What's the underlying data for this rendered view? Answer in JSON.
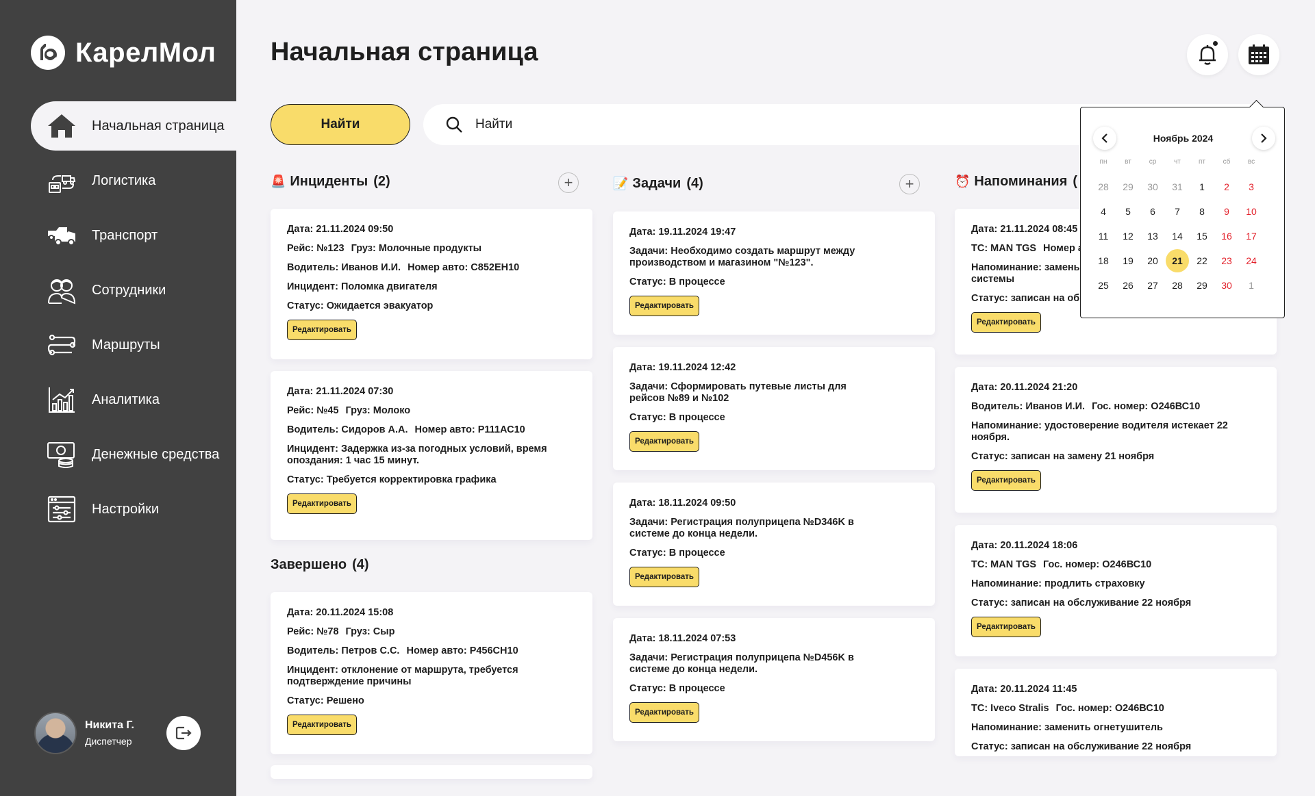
{
  "app": {
    "name": "КарелМол"
  },
  "sidebar": {
    "items": [
      {
        "label": "Начальная страница",
        "icon": "home-icon",
        "active": true
      },
      {
        "label": "Логистика",
        "icon": "logistics-icon"
      },
      {
        "label": "Транспорт",
        "icon": "truck-icon"
      },
      {
        "label": "Сотрудники",
        "icon": "employees-icon"
      },
      {
        "label": "Маршруты",
        "icon": "routes-icon"
      },
      {
        "label": "Аналитика",
        "icon": "analytics-icon"
      },
      {
        "label": "Денежные средства",
        "icon": "money-icon"
      },
      {
        "label": "Настройки",
        "icon": "settings-icon"
      }
    ]
  },
  "user": {
    "name": "Никита Г.",
    "role": "Диспетчер"
  },
  "header": {
    "title": "Начальная страница"
  },
  "search": {
    "button_label": "Найти",
    "placeholder": "Найти"
  },
  "edit_label": "Редактировать",
  "incidents": {
    "title": "Инциденты",
    "count": "(2)",
    "cards": [
      {
        "l1": "Дата: 21.11.2024 09:50",
        "l2a": "Рейс: №123",
        "l2b": "Груз: Молочные продукты",
        "l3a": "Водитель: Иванов И.И.",
        "l3b": "Номер авто: С852ЕН10",
        "l4": "Инцидент: Поломка двигателя",
        "l5": "Статус: Ожидается эвакуатор"
      },
      {
        "l1": "Дата: 21.11.2024 07:30",
        "l2a": "Рейс: №45",
        "l2b": "Груз: Молоко",
        "l3a": "Водитель: Сидоров А.А.",
        "l3b": "Номер авто: Р111АС10",
        "l4": "Инцидент: Задержка из-за погодных условий, время опоздания: 1 час 15 минут.",
        "l5": "Статус: Требуется корректировка графика"
      }
    ]
  },
  "completed": {
    "title": "Завершено",
    "count": "(4)",
    "cards": [
      {
        "l1": "Дата: 20.11.2024 15:08",
        "l2a": "Рейс: №78",
        "l2b": "Груз: Сыр",
        "l3a": "Водитель: Петров С.С.",
        "l3b": "Номер авто: Р456СН10",
        "l4": "Инцидент: отклонение от маршрута, требуется подтверждение причины",
        "l5": "Статус: Решено"
      }
    ]
  },
  "tasks": {
    "title": "Задачи",
    "count": "(4)",
    "cards": [
      {
        "date": "Дата: 19.11.2024 19:47",
        "text": "Задачи: Необходимо создать маршрут между производством и магазином \"№123\".",
        "status": "Статус: В процессе"
      },
      {
        "date": "Дата: 19.11.2024 12:42",
        "text": "Задачи: Сформировать путевые листы для рейсов №89 и №102",
        "status": "Статус: В процессе"
      },
      {
        "date": "Дата: 18.11.2024 09:50",
        "text": "Задачи: Регистрация полуприцепа №D346K в системе до конца недели.",
        "status": "Статус: В процессе"
      },
      {
        "date": "Дата: 18.11.2024 07:53",
        "text": "Задачи: Регистрация полуприцепа №D456K в системе до конца недели.",
        "status": "Статус: В процессе"
      }
    ]
  },
  "reminders": {
    "title": "Напоминания",
    "count": "(",
    "cards": [
      {
        "l1": "Дата: 21.11.2024 08:45",
        "l2a": "ТС: MAN TGS",
        "l2b": "Номер а",
        "l3": "Напоминание: замены системы",
        "l4": "Статус: записан на об"
      },
      {
        "l1": "Дата: 20.11.2024 21:20",
        "l2a": "Водитель: Иванов И.И.",
        "l2b": "Гос. номер: О246ВС10",
        "l3": "Напоминание: удостоверение водителя истекает 22 ноября.",
        "l4": "Статус: записан на замену 21 ноября"
      },
      {
        "l1": "Дата: 20.11.2024 18:06",
        "l2a": "ТС: MAN TGS",
        "l2b": "Гос. номер: О246ВС10",
        "l3": "Напоминание: продлить страховку",
        "l4": "Статус: записан на обслуживание 22 ноября"
      },
      {
        "l1": "Дата: 20.11.2024 11:45",
        "l2a": "ТС: Iveco Stralis",
        "l2b": "Гос. номер: О246ВС10",
        "l3": "Напоминание: заменить огнетушитель",
        "l4": "Статус: записан на обслуживание 22 ноября"
      }
    ]
  },
  "calendar": {
    "title": "Ноябрь 2024",
    "weekdays": [
      "пн",
      "вт",
      "ср",
      "чт",
      "пт",
      "сб",
      "вс"
    ],
    "days": [
      [
        "28",
        "29",
        "30",
        "31",
        "1",
        "2",
        "3"
      ],
      [
        "4",
        "5",
        "6",
        "7",
        "8",
        "9",
        "10"
      ],
      [
        "11",
        "12",
        "13",
        "14",
        "15",
        "16",
        "17"
      ],
      [
        "18",
        "19",
        "20",
        "21",
        "22",
        "23",
        "24"
      ],
      [
        "25",
        "26",
        "27",
        "28",
        "29",
        "30",
        "1"
      ]
    ],
    "selected": "21"
  },
  "colors": {
    "sidebar": "#414141",
    "accent": "#f9dc6a",
    "weekend": "#e3202a",
    "background": "#f4f3f6"
  }
}
